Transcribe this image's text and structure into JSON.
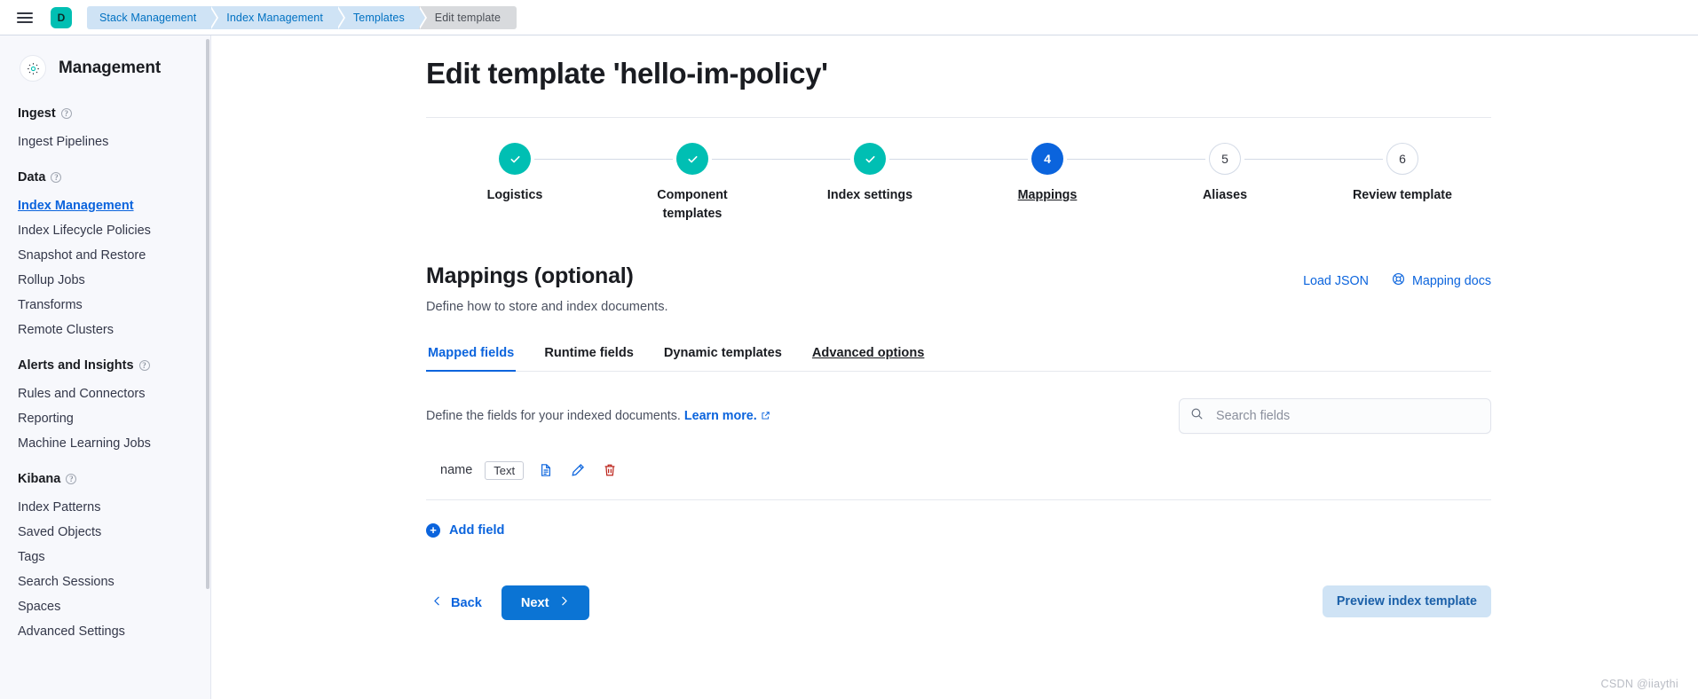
{
  "header": {
    "menu_icon": "hamburger-icon",
    "avatar_letter": "D",
    "breadcrumbs": [
      {
        "label": "Stack Management",
        "current": false
      },
      {
        "label": "Index Management",
        "current": false
      },
      {
        "label": "Templates",
        "current": false
      },
      {
        "label": "Edit template",
        "current": true
      }
    ]
  },
  "sidebar": {
    "icon": "gear-icon",
    "title": "Management",
    "groups": [
      {
        "title": "Ingest",
        "help_icon": "question-icon",
        "items": [
          {
            "label": "Ingest Pipelines",
            "active": false
          }
        ]
      },
      {
        "title": "Data",
        "help_icon": "question-icon",
        "items": [
          {
            "label": "Index Management",
            "active": true
          },
          {
            "label": "Index Lifecycle Policies",
            "active": false
          },
          {
            "label": "Snapshot and Restore",
            "active": false
          },
          {
            "label": "Rollup Jobs",
            "active": false
          },
          {
            "label": "Transforms",
            "active": false
          },
          {
            "label": "Remote Clusters",
            "active": false
          }
        ]
      },
      {
        "title": "Alerts and Insights",
        "help_icon": "question-icon",
        "items": [
          {
            "label": "Rules and Connectors",
            "active": false
          },
          {
            "label": "Reporting",
            "active": false
          },
          {
            "label": "Machine Learning Jobs",
            "active": false
          }
        ]
      },
      {
        "title": "Kibana",
        "help_icon": "question-icon",
        "items": [
          {
            "label": "Index Patterns",
            "active": false
          },
          {
            "label": "Saved Objects",
            "active": false
          },
          {
            "label": "Tags",
            "active": false
          },
          {
            "label": "Search Sessions",
            "active": false
          },
          {
            "label": "Spaces",
            "active": false
          },
          {
            "label": "Advanced Settings",
            "active": false
          }
        ]
      }
    ]
  },
  "main": {
    "page_title": "Edit template 'hello-im-policy'",
    "steps": [
      {
        "label": "Logistics",
        "state": "done",
        "marker": "check"
      },
      {
        "label": "Component templates",
        "state": "done",
        "marker": "check"
      },
      {
        "label": "Index settings",
        "state": "done",
        "marker": "check"
      },
      {
        "label": "Mappings",
        "state": "current",
        "marker": "4"
      },
      {
        "label": "Aliases",
        "state": "todo",
        "marker": "5"
      },
      {
        "label": "Review template",
        "state": "todo",
        "marker": "6"
      }
    ],
    "section": {
      "title": "Mappings (optional)",
      "subtitle": "Define how to store and index documents.",
      "links": [
        {
          "label": "Load JSON",
          "icon": null
        },
        {
          "label": "Mapping docs",
          "icon": "help-lifebuoy-icon"
        }
      ]
    },
    "tabs": [
      {
        "label": "Mapped fields",
        "active": true,
        "underlined": false
      },
      {
        "label": "Runtime fields",
        "active": false,
        "underlined": false
      },
      {
        "label": "Dynamic templates",
        "active": false,
        "underlined": false
      },
      {
        "label": "Advanced options",
        "active": false,
        "underlined": true
      }
    ],
    "fields_description": "Define the fields for your indexed documents.",
    "fields_learn_more": "Learn more.",
    "search": {
      "placeholder": "Search fields",
      "value": "",
      "icon": "search-icon"
    },
    "fields": [
      {
        "name": "name",
        "type": "Text",
        "actions": [
          {
            "icon": "document-icon",
            "color": "#0b64dd"
          },
          {
            "icon": "pencil-edit-icon",
            "color": "#0b64dd"
          },
          {
            "icon": "trash-delete-icon",
            "color": "#bd271e"
          }
        ]
      }
    ],
    "add_field_label": "Add field",
    "footer": {
      "back_label": "Back",
      "next_label": "Next",
      "preview_label": "Preview index template"
    }
  },
  "watermark": "CSDN @iiaythi",
  "colors": {
    "accent_blue": "#0b64dd",
    "primary_button": "#0b74d4",
    "teal_done": "#00bfb3",
    "danger_red": "#bd271e",
    "breadcrumb_bg": "#cfe3f5"
  }
}
